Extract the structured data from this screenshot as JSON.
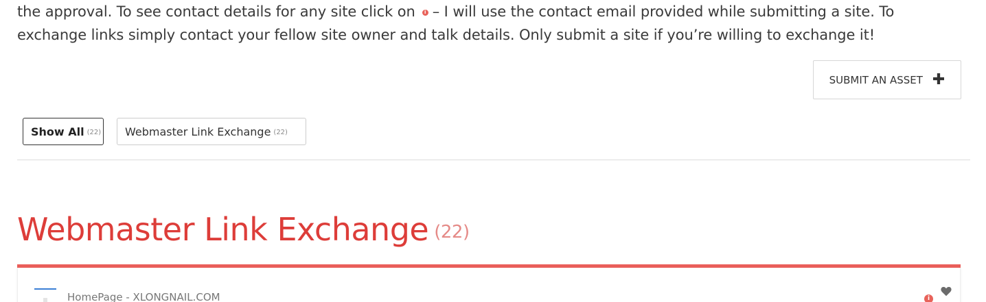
{
  "intro": {
    "line1_before_icon": "the approval. To see contact details for any site click on",
    "info_icon": "info-icon",
    "line1_after_icon": "–  I will use the contact email provided while submitting a site. To",
    "line2": "exchange links simply contact your fellow site owner and talk details. Only submit a site if you’re willing to exchange it!"
  },
  "submit_button": {
    "label": "SUBMIT AN ASSET",
    "icon": "plus-icon"
  },
  "filters": [
    {
      "label": "Show All",
      "count": "(22)",
      "active": true
    },
    {
      "label": "Webmaster Link Exchange",
      "count": "(22)",
      "active": false
    }
  ],
  "section": {
    "title": "Webmaster Link Exchange",
    "count": "(22)"
  },
  "listing": {
    "title": "HomePage - XLONGNAIL.COM",
    "info_icon": "info-icon",
    "favorite_icon": "heart-icon"
  },
  "colors": {
    "accent_red": "#dd3d39",
    "bar_red": "#ea5f5a",
    "thumb_blue": "#3a7fd5"
  }
}
